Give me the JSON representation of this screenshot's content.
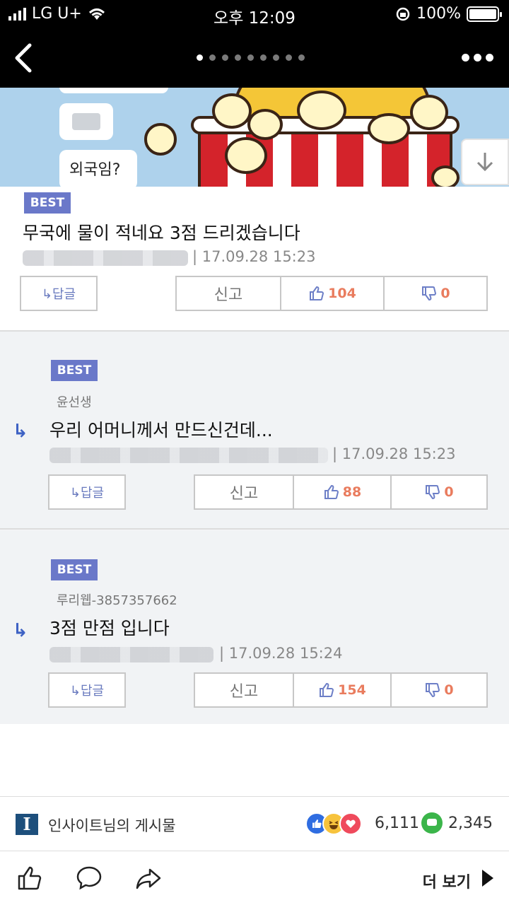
{
  "status": {
    "carrier": "LG U+",
    "time": "오후 12:09",
    "battery": "100%"
  },
  "nav": {
    "page_count": 9,
    "active_index": 0
  },
  "banner": {
    "chat_text": "외국임?"
  },
  "comments": [
    {
      "badge": "BEST",
      "author": "",
      "text": "무국에 물이 적네요 3점 드리겠습니다",
      "date": "17.09.28 15:23",
      "reply": "↳답글",
      "report": "신고",
      "up": "104",
      "down": "0",
      "is_reply": false
    },
    {
      "badge": "BEST",
      "author": "윤선생",
      "text": "우리 어머니께서 만드신건데...",
      "date": "17.09.28 15:23",
      "reply": "↳답글",
      "report": "신고",
      "up": "88",
      "down": "0",
      "is_reply": true
    },
    {
      "badge": "BEST",
      "author": "루리웹-3857357662",
      "text": "3점 만점 입니다",
      "date": "17.09.28 15:24",
      "reply": "↳답글",
      "report": "신고",
      "up": "154",
      "down": "0",
      "is_reply": true
    }
  ],
  "post": {
    "logo_letter": "I",
    "page_name": "인사이트님의 게시물",
    "reactions_count": "6,111",
    "comments_count": "2,345"
  },
  "actions": {
    "more_label": "더 보기"
  }
}
